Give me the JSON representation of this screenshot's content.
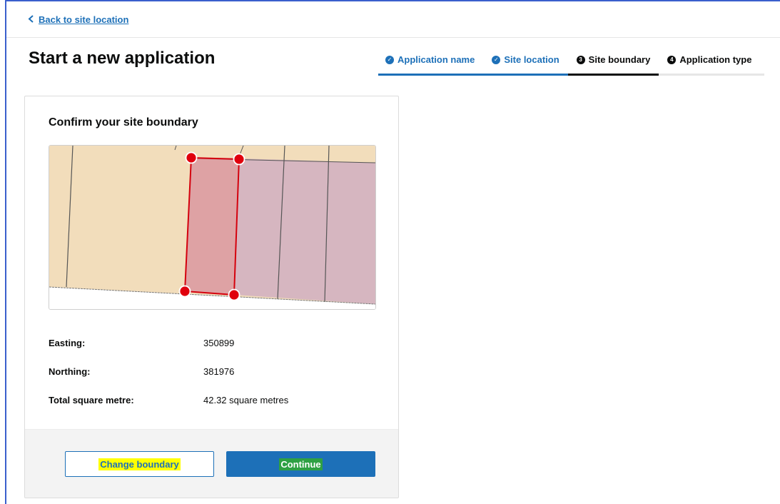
{
  "nav": {
    "back_label": "Back to site location"
  },
  "page": {
    "title": "Start a new application"
  },
  "steps": [
    {
      "badge": "✓",
      "label": "Application name",
      "state": "done"
    },
    {
      "badge": "✓",
      "label": "Site location",
      "state": "done"
    },
    {
      "badge": "3",
      "label": "Site boundary",
      "state": "current"
    },
    {
      "badge": "4",
      "label": "Application type",
      "state": "todo"
    }
  ],
  "card": {
    "title": "Confirm your site boundary",
    "details": [
      {
        "label": "Easting:",
        "value": "350899"
      },
      {
        "label": "Northing:",
        "value": "381976"
      },
      {
        "label": "Total square metre:",
        "value": "42.32 square metres"
      }
    ],
    "buttons": {
      "change_label": "Change boundary",
      "continue_label": "Continue"
    }
  },
  "colors": {
    "link": "#1d70b8",
    "primary_button": "#1d70b8",
    "boundary": "#d4000d",
    "map_land": "#f2ddbb",
    "map_buildings": "#d6b6c0",
    "highlight_yellow": "#ffff00",
    "highlight_green": "#2ea043"
  }
}
